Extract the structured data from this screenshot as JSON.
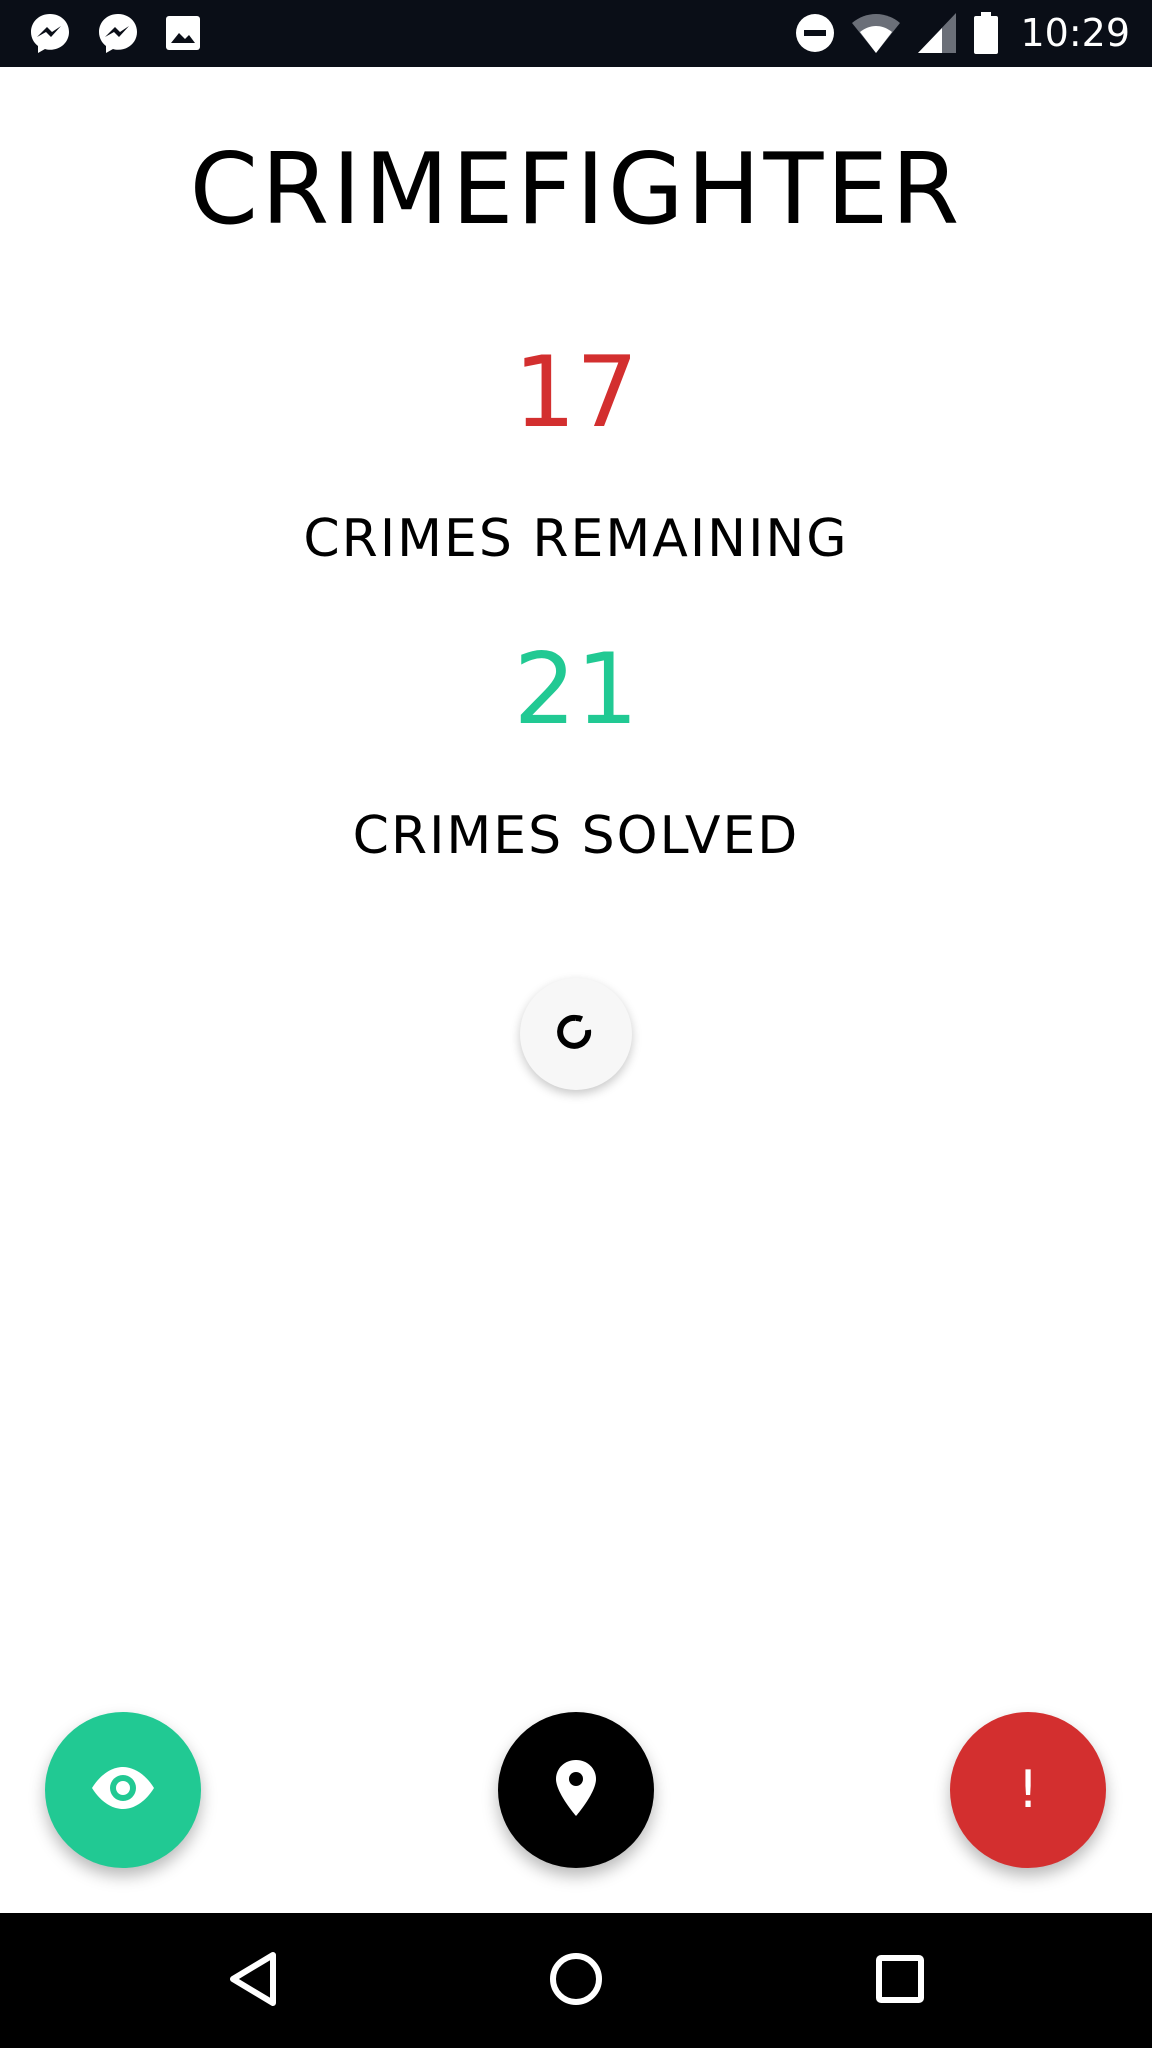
{
  "status_bar": {
    "time": "10:29",
    "notification_icons": [
      "messenger-icon",
      "messenger-icon",
      "image-icon"
    ],
    "system_icons": [
      "do-not-disturb-icon",
      "wifi-icon",
      "signal-icon",
      "battery-icon"
    ],
    "background_color": "#0a0e17"
  },
  "app": {
    "title": "CRIMEFIGHTER"
  },
  "stats": {
    "remaining": {
      "value": "17",
      "label": "CRIMES REMAINING",
      "color": "#d32f2f"
    },
    "solved": {
      "value": "21",
      "label": "CRIMES SOLVED",
      "color": "#21c993"
    }
  },
  "refresh": {
    "icon": "refresh-icon"
  },
  "actions": {
    "watch": {
      "icon": "eye-icon",
      "color": "#21c993"
    },
    "location": {
      "icon": "location-pin-icon",
      "color": "#000000"
    },
    "report": {
      "label": "!",
      "color": "#d32f2f"
    }
  },
  "nav_bar": {
    "buttons": [
      "back-icon",
      "home-icon",
      "recents-icon"
    ]
  }
}
